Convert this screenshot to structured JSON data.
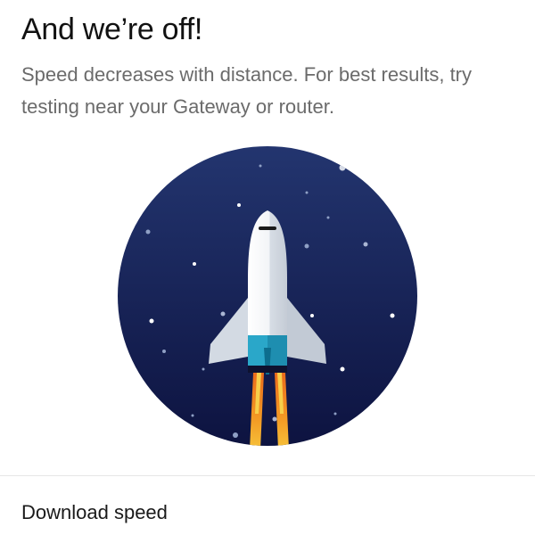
{
  "header": {
    "title": "And we’re off!",
    "subtitle": "Speed decreases with distance. For best results, try testing near your Gateway or router."
  },
  "illustration": {
    "icon": "rocket-launch-icon",
    "colors": {
      "sky_top": "#1f2f6b",
      "sky_bottom": "#0e1440",
      "rocket_body": "#f3f5f8",
      "rocket_shade": "#c9d0da",
      "nozzle": "#2aa7c9",
      "flame_outer": "#f07a1d",
      "flame_inner": "#f4b32a"
    }
  },
  "results": {
    "download_label": "Download speed"
  }
}
